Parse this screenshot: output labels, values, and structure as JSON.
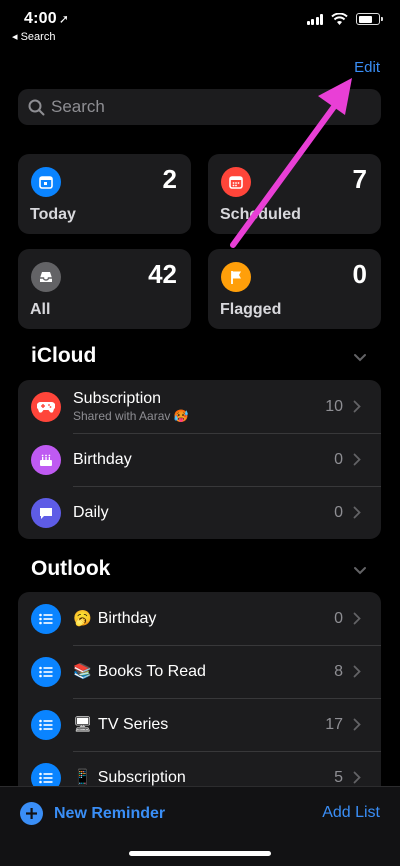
{
  "status_bar": {
    "time": "4:00",
    "back_app": "◂ Search"
  },
  "header": {
    "edit_label": "Edit"
  },
  "search": {
    "placeholder": "Search"
  },
  "smart_lists": [
    {
      "label": "Today",
      "count": "2",
      "color": "#0a84ff",
      "icon": "calendar-today-icon"
    },
    {
      "label": "Scheduled",
      "count": "7",
      "color": "#ff453a",
      "icon": "calendar-icon"
    },
    {
      "label": "All",
      "count": "42",
      "color": "#636366",
      "icon": "tray-icon"
    },
    {
      "label": "Flagged",
      "count": "0",
      "color": "#ff9f0a",
      "icon": "flag-icon"
    }
  ],
  "icloud": {
    "title": "iCloud",
    "lists": [
      {
        "title": "Subscription",
        "subtitle": "Shared with Aarav 🥵",
        "count": "10",
        "color": "#ff453a",
        "icon": "gamepad-icon"
      },
      {
        "title": "Birthday",
        "count": "0",
        "color": "#bf5af2",
        "icon": "cake-icon"
      },
      {
        "title": "Daily",
        "count": "0",
        "color": "#5e5ce6",
        "icon": "speech-bubble-icon"
      }
    ]
  },
  "outlook": {
    "title": "Outlook",
    "lists": [
      {
        "emoji": "🥱",
        "title": "Birthday",
        "count": "0",
        "color": "#0a84ff",
        "icon": "list-icon"
      },
      {
        "emoji": "📚",
        "title": "Books To Read",
        "count": "8",
        "color": "#0a84ff",
        "icon": "list-icon"
      },
      {
        "emoji": "🖥",
        "title": "TV Series",
        "count": "17",
        "color": "#0a84ff",
        "icon": "list-icon"
      },
      {
        "emoji": "📱",
        "title": "Subscription",
        "count": "5",
        "color": "#0a84ff",
        "icon": "list-icon"
      }
    ]
  },
  "toolbar": {
    "new_reminder": "New Reminder",
    "add_list": "Add List"
  },
  "colors": {
    "accent": "#3a8ef6",
    "annotation_arrow": "#e93fd6"
  }
}
